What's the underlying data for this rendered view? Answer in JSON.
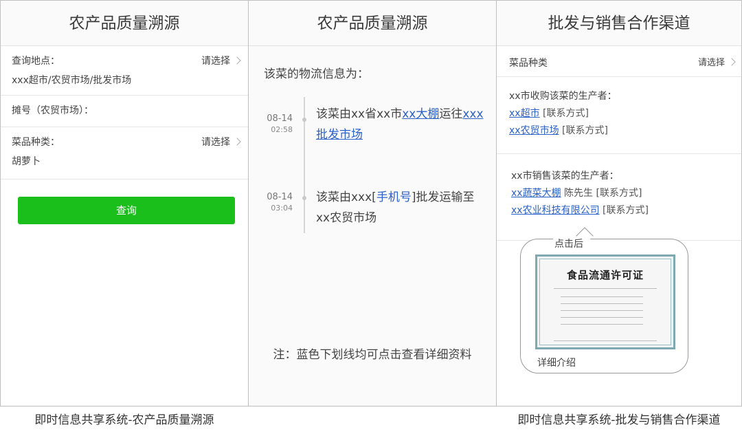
{
  "panel1": {
    "title": "农产品质量溯源",
    "location_label": "查询地点：",
    "location_pick": "请选择",
    "location_value": "xxx超市/农贸市场/批发市场",
    "stall_label": "摊号（农贸市场）：",
    "category_label": "菜品种类：",
    "category_pick": "请选择",
    "category_value": "胡萝卜",
    "query_button": "查询",
    "footer": "即时信息共享系统-农产品质量溯源"
  },
  "panel2": {
    "title": "农产品质量溯源",
    "intro": "该菜的物流信息为：",
    "events": [
      {
        "date": "08-14",
        "time": "02:58",
        "t1": "该菜由xx省xx市",
        "link1": "xx大棚",
        "t2": "运往",
        "link2a": "xxx",
        "link2b": "批发市场"
      },
      {
        "date": "08-14",
        "time": "03:04",
        "t1": "该菜由xxx[",
        "phone": "手机号",
        "t2": "]批发运输至",
        "t3": "xx农贸市场"
      }
    ],
    "note": "注：蓝色下划线均可点击查看详细资料"
  },
  "panel3": {
    "title": "批发与销售合作渠道",
    "category_label": "菜品种类",
    "category_pick": "请选择",
    "buyers_heading": "xx市收购该菜的生产者：",
    "buyers": [
      {
        "name": "xx超市",
        "contact": "[联系方式]"
      },
      {
        "name": "xx农贸市场",
        "contact": "[联系方式]"
      }
    ],
    "sellers_heading": "xx市销售该菜的生产者：",
    "sellers": [
      {
        "name": "xx蔬菜大棚",
        "person": "陈先生",
        "contact": "[联系方式]"
      },
      {
        "name": "xx农业科技有限公司",
        "contact": "[联系方式]"
      }
    ],
    "popup_caption": "点击后",
    "cert_title": "食品流通许可证",
    "popup_footer": "详细介绍",
    "footer": "即时信息共享系统-批发与销售合作渠道"
  },
  "colors": {
    "button_green": "#1bbf1b",
    "link_blue": "#2a62c9"
  }
}
